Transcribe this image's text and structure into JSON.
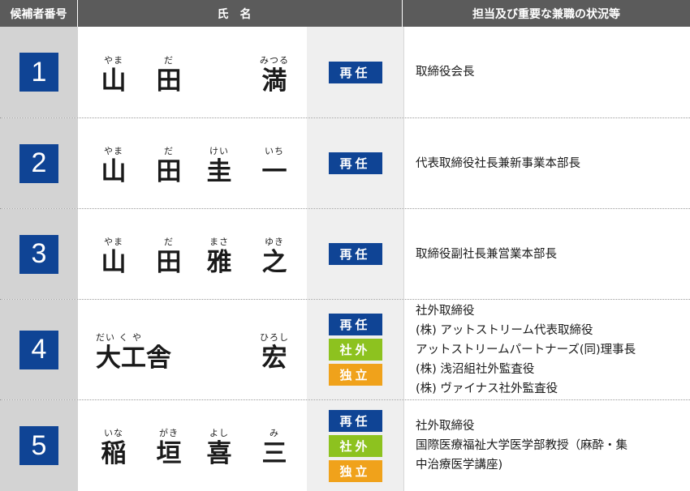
{
  "header": {
    "number": "候補者番号",
    "name": "氏名",
    "role": "担当及び重要な兼職の状況等"
  },
  "candidates": [
    {
      "number": "1",
      "name": [
        {
          "ruby": "やま",
          "kanji": "山"
        },
        {
          "ruby": "だ",
          "kanji": "田"
        },
        {
          "ruby": "",
          "kanji": ""
        },
        {
          "ruby": "みつる",
          "kanji": "満"
        }
      ],
      "tags": [
        "再任"
      ],
      "roles": [
        "取締役会長"
      ]
    },
    {
      "number": "2",
      "name": [
        {
          "ruby": "やま",
          "kanji": "山"
        },
        {
          "ruby": "だ",
          "kanji": "田"
        },
        {
          "ruby": "けい",
          "kanji": "圭"
        },
        {
          "ruby": "いち",
          "kanji": "一"
        }
      ],
      "tags": [
        "再任"
      ],
      "roles": [
        "代表取締役社長兼新事業本部長"
      ]
    },
    {
      "number": "3",
      "name": [
        {
          "ruby": "やま",
          "kanji": "山"
        },
        {
          "ruby": "だ",
          "kanji": "田"
        },
        {
          "ruby": "まさ",
          "kanji": "雅"
        },
        {
          "ruby": "ゆき",
          "kanji": "之"
        }
      ],
      "tags": [
        "再任"
      ],
      "roles": [
        "取締役副社長兼営業本部長"
      ]
    },
    {
      "number": "4",
      "name_wide": {
        "ruby": "だい く や",
        "kanji": "大工舎"
      },
      "name": [
        {
          "ruby": "",
          "kanji": ""
        },
        {
          "ruby": "",
          "kanji": ""
        },
        {
          "ruby": "",
          "kanji": ""
        },
        {
          "ruby": "ひろし",
          "kanji": "宏"
        }
      ],
      "tags": [
        "再任",
        "社外",
        "独立"
      ],
      "roles": [
        "社外取締役",
        "(株) アットストリーム代表取締役",
        "アットストリームパートナーズ(同)理事長",
        "(株) 浅沼組社外監査役",
        "(株) ヴァイナス社外監査役"
      ]
    },
    {
      "number": "5",
      "name": [
        {
          "ruby": "いな",
          "kanji": "稲"
        },
        {
          "ruby": "がき",
          "kanji": "垣"
        },
        {
          "ruby": "よし",
          "kanji": "喜"
        },
        {
          "ruby": "み",
          "kanji": "三"
        }
      ],
      "tags": [
        "再任",
        "社外",
        "独立"
      ],
      "roles": [
        "社外取締役",
        "国際医療福祉大学医学部教授（麻酔・集",
        "中治療医学講座)"
      ]
    }
  ],
  "colors": {
    "header_bg": "#5b5b5b",
    "number_box": "#0f4495",
    "tag_reappoint": "#0f4495",
    "tag_outside": "#8dc21f",
    "tag_independent": "#f0a21b"
  }
}
